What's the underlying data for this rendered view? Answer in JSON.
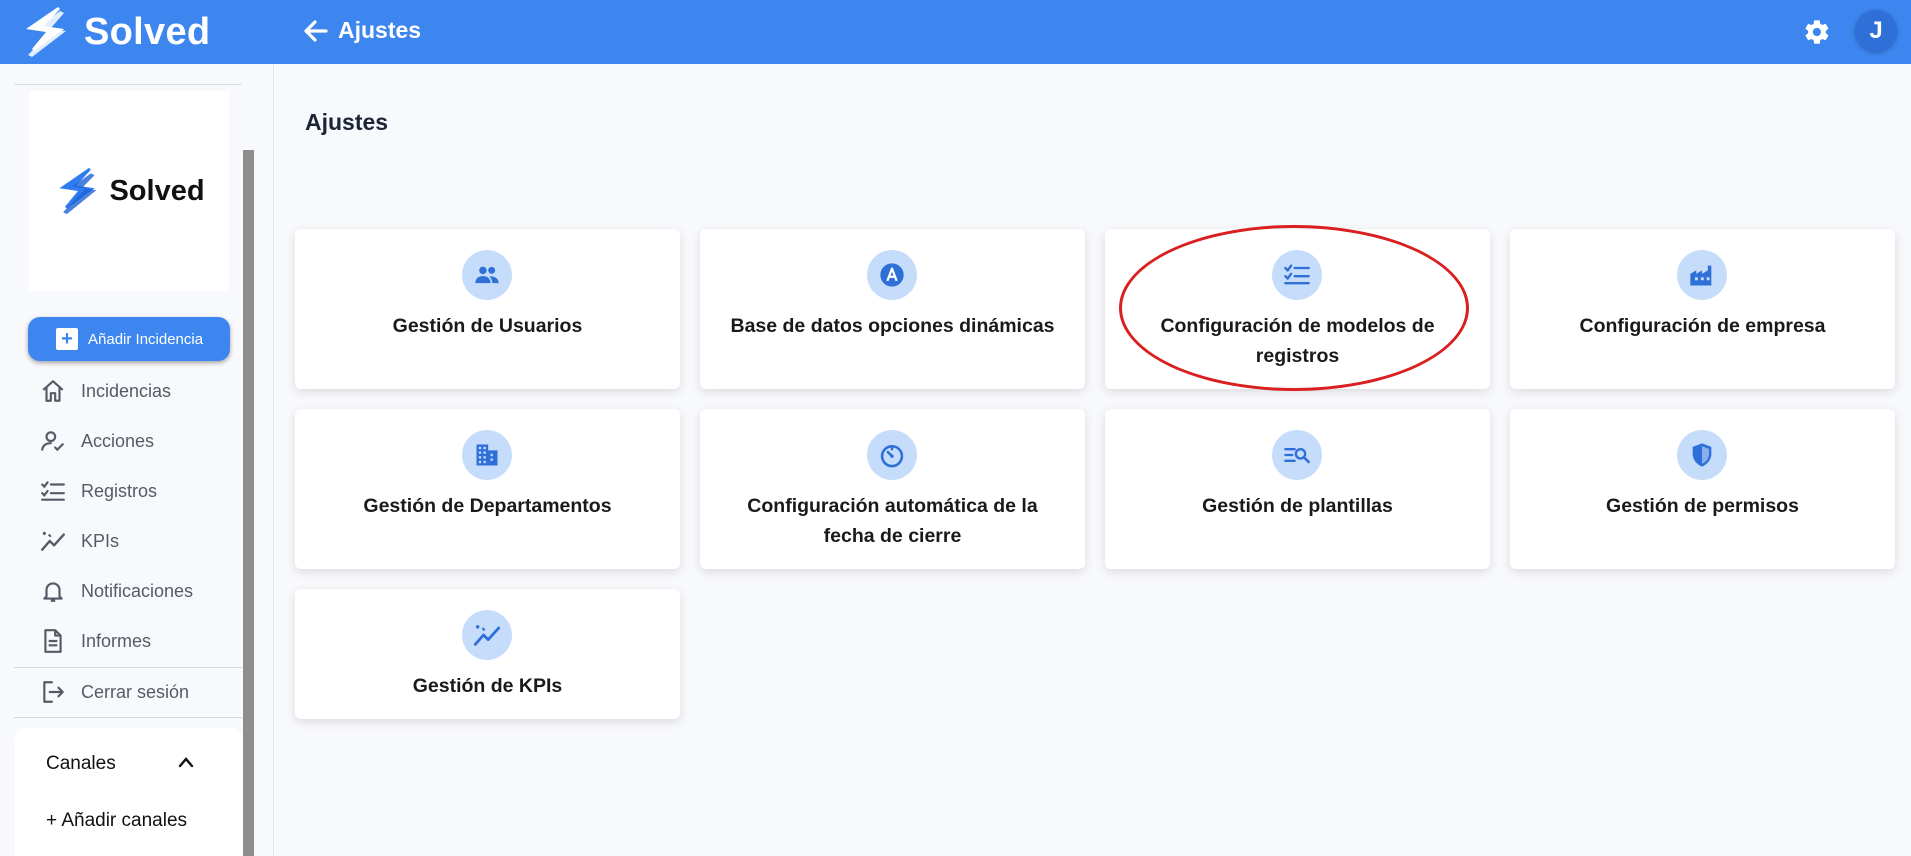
{
  "topbar": {
    "brand": "Solved",
    "title": "Ajustes",
    "avatar_initial": "J",
    "back_icon": "arrow-left-icon",
    "settings_icon": "gear-icon",
    "color": "#3d86ef"
  },
  "sidebar": {
    "logo_text": "Solved",
    "add_button": "Añadir Incidencia",
    "items": [
      {
        "label": "Incidencias",
        "icon": "home-icon"
      },
      {
        "label": "Acciones",
        "icon": "person-check-icon"
      },
      {
        "label": "Registros",
        "icon": "checklist-icon"
      },
      {
        "label": "KPIs",
        "icon": "trending-icon"
      },
      {
        "label": "Notificaciones",
        "icon": "bell-icon"
      },
      {
        "label": "Informes",
        "icon": "document-icon"
      },
      {
        "label": "Cerrar sesión",
        "icon": "logout-icon"
      }
    ],
    "channels": {
      "title": "Canales",
      "add": "+ Añadir canales"
    }
  },
  "main": {
    "title": "Ajustes",
    "cards": [
      {
        "label": "Gestión de Usuarios",
        "icon": "users-icon"
      },
      {
        "label": "Base de datos opciones dinámicas",
        "icon": "letter-a-icon"
      },
      {
        "label": "Configuración de modelos de registros",
        "icon": "checklist-icon",
        "highlighted": true
      },
      {
        "label": "Configuración de empresa",
        "icon": "factory-icon"
      },
      {
        "label": "Gestión de Departamentos",
        "icon": "building-icon"
      },
      {
        "label": "Configuración automática de la fecha de cierre",
        "icon": "timer-icon"
      },
      {
        "label": "Gestión de plantillas",
        "icon": "search-list-icon"
      },
      {
        "label": "Gestión de permisos",
        "icon": "shield-icon"
      },
      {
        "label": "Gestión de KPIs",
        "icon": "trending-icon"
      }
    ],
    "highlight_color": "#d91f1f",
    "icon_bg": "#c6dcfb",
    "icon_color": "#2e6fd8"
  }
}
